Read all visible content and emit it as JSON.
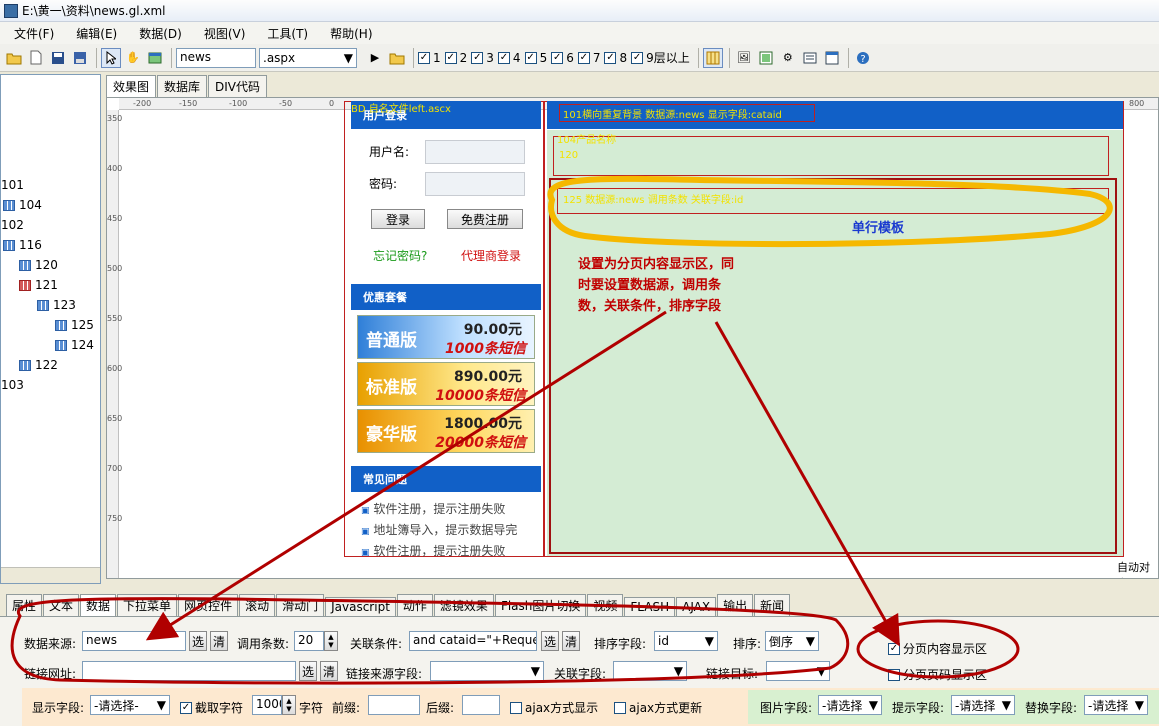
{
  "window": {
    "title": "E:\\黄一\\资料\\news.gl.xml"
  },
  "menu": [
    "文件(F)",
    "编辑(E)",
    "数据(D)",
    "视图(V)",
    "工具(T)",
    "帮助(H)"
  ],
  "toolbar": {
    "name_value": "news",
    "ext_value": ".aspx",
    "checks": [
      "1",
      "2",
      "3",
      "4",
      "5",
      "6",
      "7",
      "8",
      "9层以上"
    ]
  },
  "tree": {
    "items": [
      "101",
      "104",
      "102",
      "116",
      "120",
      "121",
      "123",
      "125",
      "124",
      "122",
      "103"
    ]
  },
  "view_tabs": [
    "效果图",
    "数据库",
    "DIV代码"
  ],
  "ruler": {
    "top": [
      "-200",
      "-150",
      "-100",
      "-50",
      "0",
      "800"
    ],
    "left": [
      "350",
      "400",
      "450",
      "500",
      "550",
      "600",
      "650",
      "700",
      "750"
    ]
  },
  "design": {
    "left_tag": "BD 自名文件left.ascx",
    "login_title": "用户登录",
    "username_label": "用户名:",
    "password_label": "密码:",
    "login_btn": "登录",
    "register_btn": "免费注册",
    "forgot_link": "忘记密码?",
    "agent_link": "代理商登录",
    "packages_title": "优惠套餐",
    "packages": [
      {
        "name": "普通版",
        "price": "90.00元",
        "sms": "1000条短信"
      },
      {
        "name": "标准版",
        "price": "890.00元",
        "sms": "10000条短信"
      },
      {
        "name": "豪华版",
        "price": "1800.00元",
        "sms": "20000条短信"
      }
    ],
    "faq_title": "常见问题",
    "faq_items": [
      "软件注册，提示注册失败",
      "地址簿导入，提示数据导完",
      "软件注册，提示注册失败"
    ],
    "top_tag": "101横向重复背景 数据源:news 显示字段:cataid",
    "tag_104": "104产品名称",
    "tag_120": "120",
    "tag_125": "125 数据源:news 调用条数 关联字段:id",
    "row_template": "单行模板",
    "right_status": "自动对齐"
  },
  "annotation": {
    "lines": [
      "设置为分页内容显示区，同",
      "时要设置数据源，调用条",
      "数，关联条件，排序字段"
    ]
  },
  "bottom_tabs": [
    "属性",
    "文本",
    "数据",
    "下拉菜单",
    "网页控件",
    "滚动",
    "滑动门",
    "Javascript",
    "动作",
    "滤镜效果",
    "Flash图片切换",
    "视频",
    "FLASH",
    "AJAX",
    "输出",
    "新闻"
  ],
  "props": {
    "datasource_label": "数据来源:",
    "datasource_value": "news",
    "select_btn": "选",
    "clear_btn": "清",
    "count_label": "调用条数:",
    "count_value": "20",
    "relation_label": "关联条件:",
    "relation_value": "and cataid=\"+Reques",
    "sort_field_label": "排序字段:",
    "sort_field_value": "id",
    "order_label": "排序:",
    "order_value": "倒序",
    "paging_content_label": "分页内容显示区",
    "paging_number_label": "分页页码显示区",
    "link_label": "链接网址:",
    "link_source_label": "链接来源字段:",
    "link_field_label": "关联字段:",
    "link_target_label": "链接目标:",
    "show_field_label": "显示字段:",
    "show_field_value": "-请选择-",
    "truncate_label": "截取字符",
    "truncate_value": "1000",
    "char_label": "字符",
    "prefix_label": "前缀:",
    "suffix_label": "后缀:",
    "ajax_show_label": "ajax方式显示",
    "ajax_update_label": "ajax方式更新",
    "image_field_label": "图片字段:",
    "image_field_value": "-请选择",
    "tip_field_label": "提示字段:",
    "tip_field_value": "-请选择",
    "replace_field_label": "替换字段:",
    "replace_field_value": "-请选择"
  },
  "colors": {
    "accent_blue": "#1160c7",
    "annotation_red": "#c00000",
    "highlight_yellow": "#f5b800",
    "panel_green": "#d4ecd4"
  }
}
